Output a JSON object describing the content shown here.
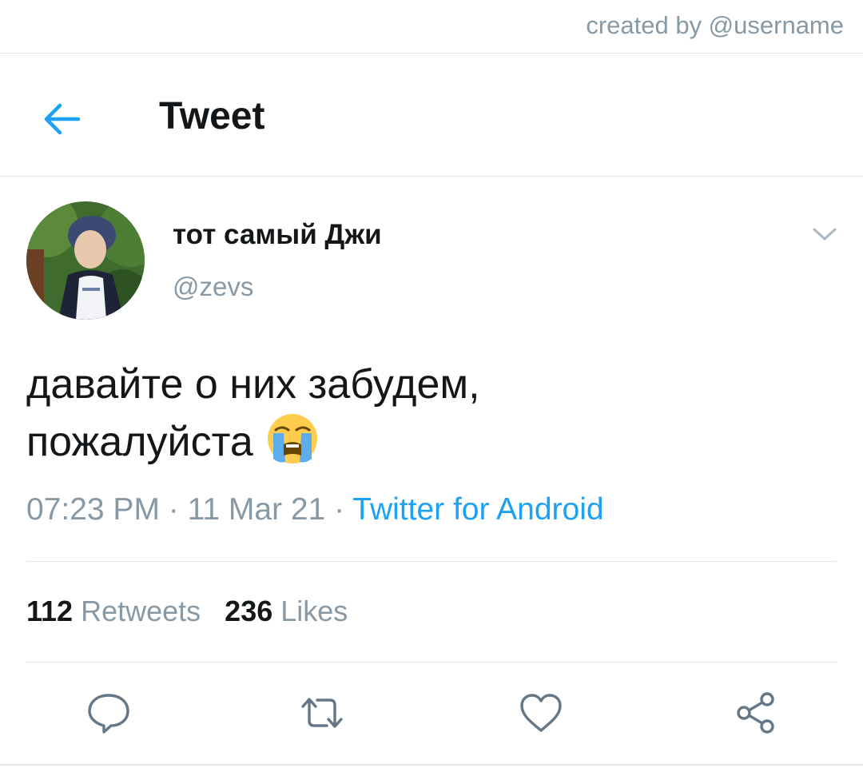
{
  "credit": "created by @username",
  "header": {
    "title": "Tweet",
    "back_icon": "arrow-left-icon",
    "accent_color": "#1da1f2"
  },
  "tweet": {
    "display_name": "тот самый Джи",
    "handle": "@zevs",
    "text_line1": "давайте о них забудем,",
    "text_line2": "пожалуйста",
    "emoji": "loudly-crying-face-emoji",
    "time": "07:23 PM",
    "date": "11 Mar 21",
    "separator": " · ",
    "source": "Twitter for Android",
    "retweets_count": "112",
    "retweets_label": "Retweets",
    "likes_count": "236",
    "likes_label": "Likes"
  },
  "actions": {
    "reply_icon": "reply-icon",
    "retweet_icon": "retweet-icon",
    "like_icon": "heart-icon",
    "share_icon": "share-icon"
  }
}
